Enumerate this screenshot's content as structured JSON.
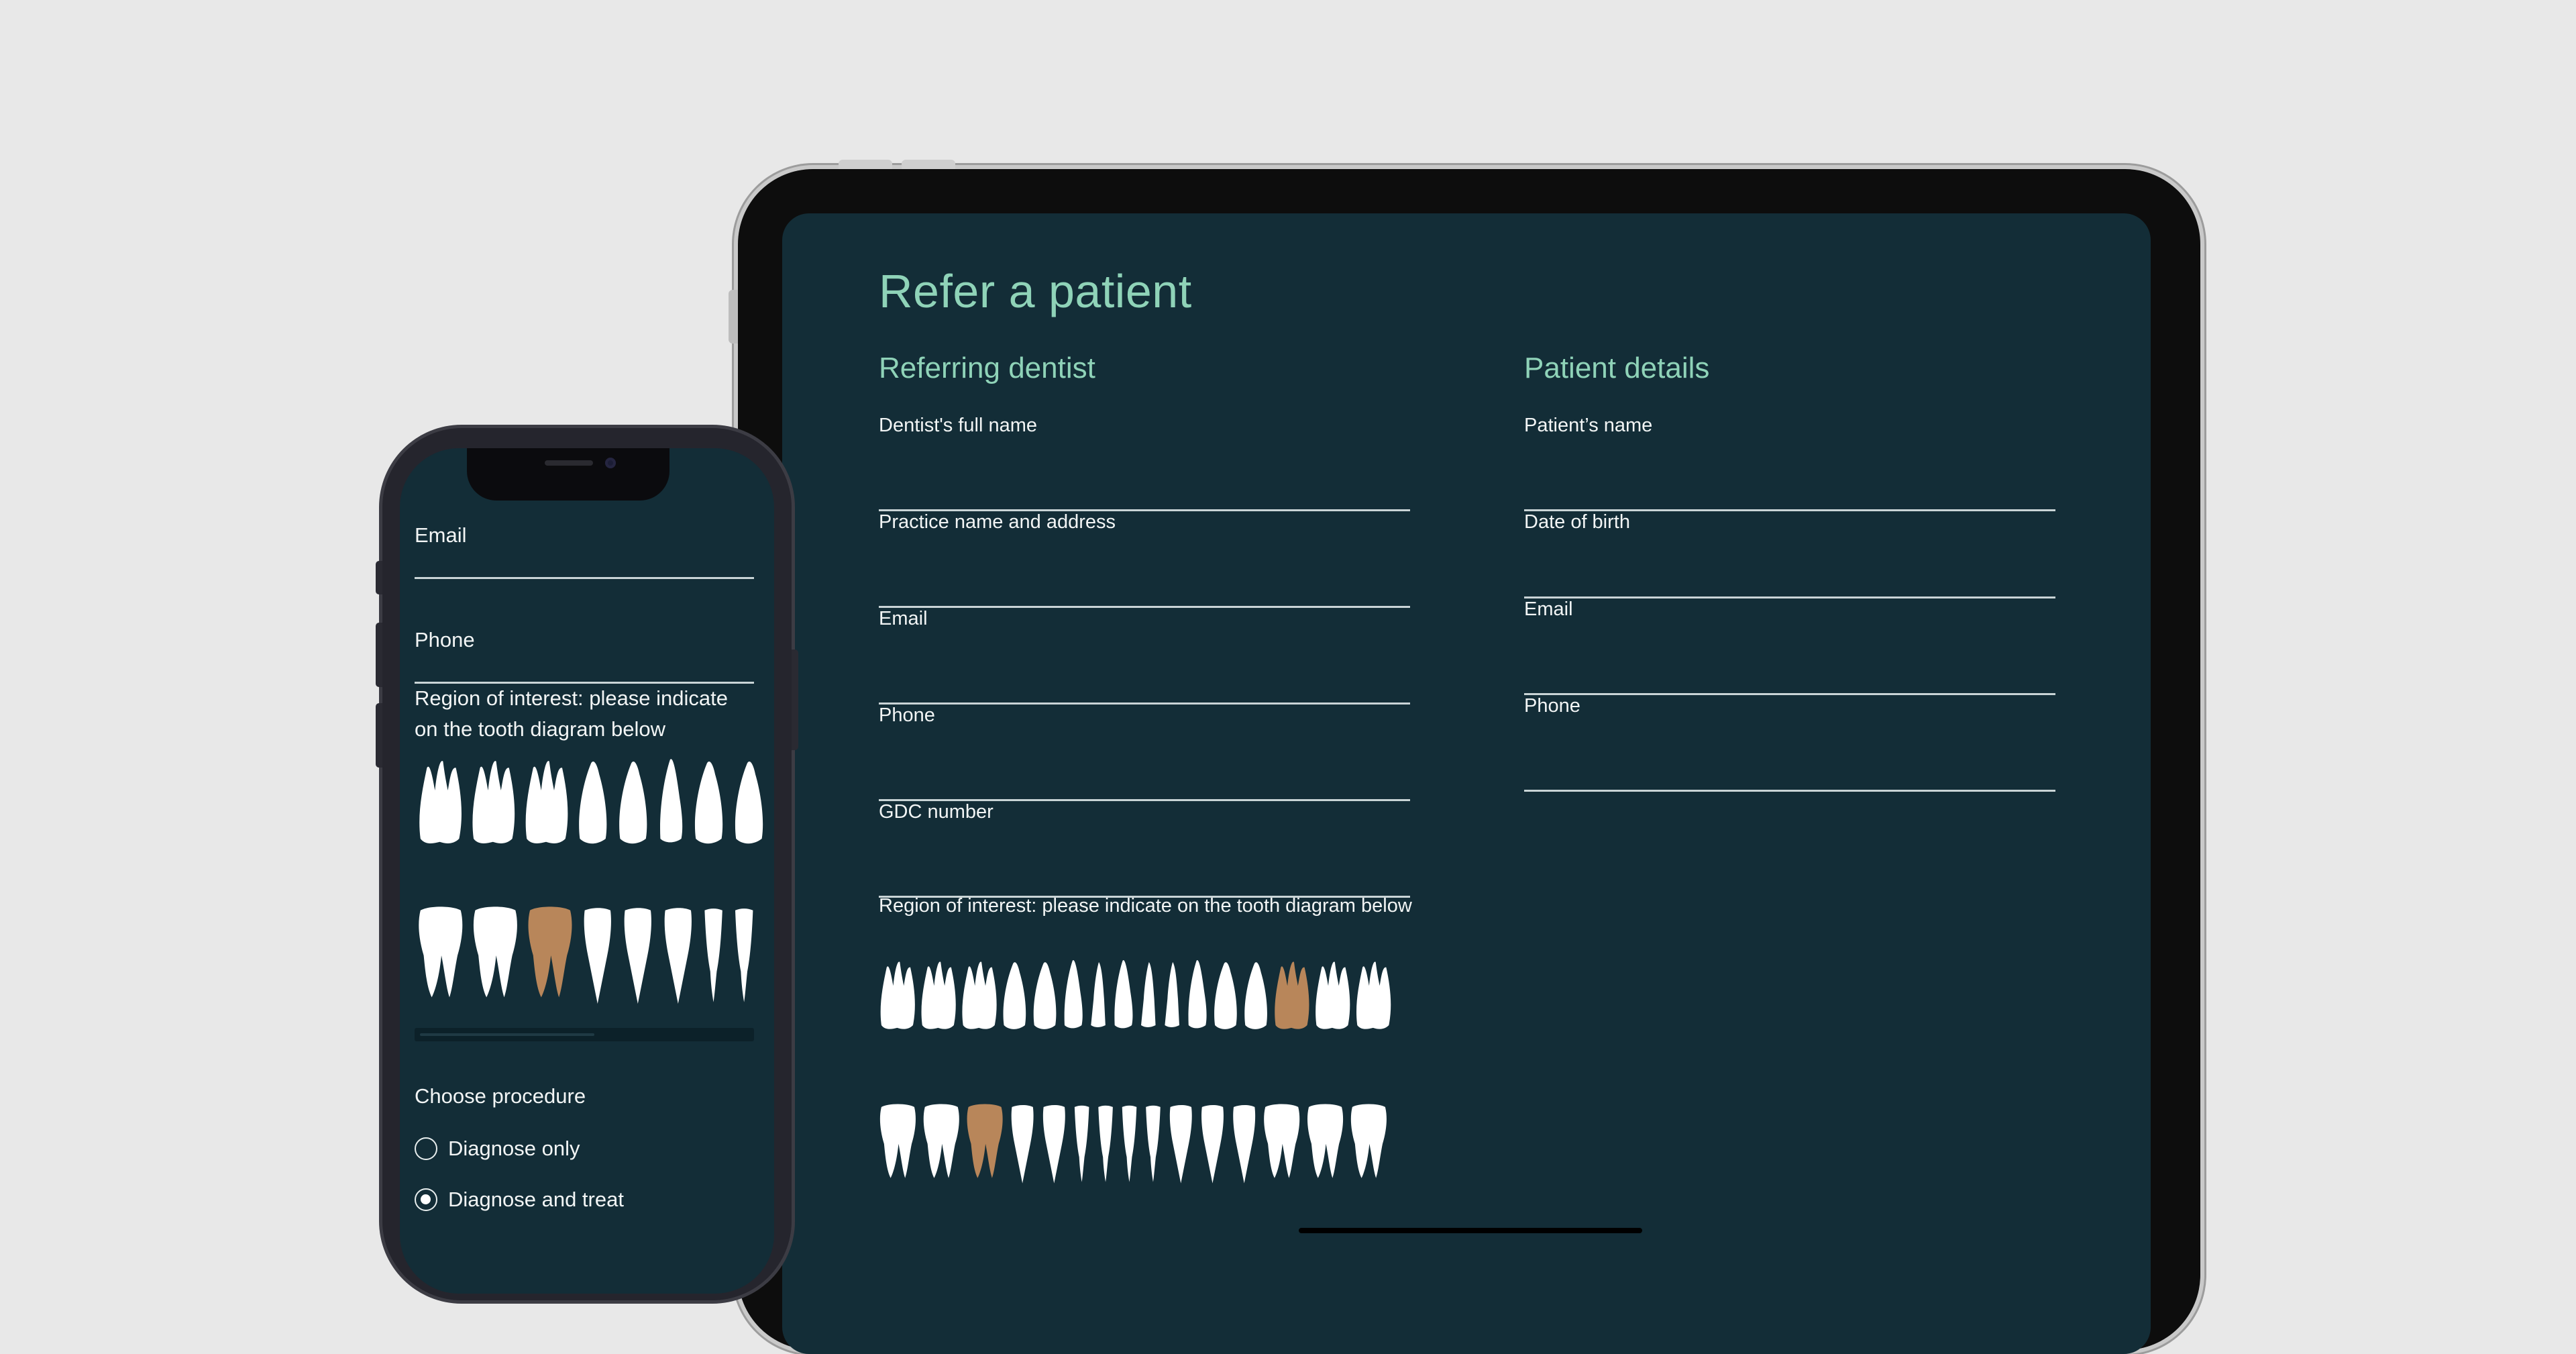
{
  "colors": {
    "background": "#e8e8e8",
    "screen_bg": "#132d37",
    "accent_heading": "#8fd3b8",
    "tooth_default": "#ffffff",
    "tooth_selected": "#b8865a",
    "field_line": "#c9d4d6"
  },
  "tablet": {
    "title": "Refer a patient",
    "referring_dentist": {
      "heading": "Referring dentist",
      "fields": [
        {
          "label": "Dentist's full name"
        },
        {
          "label": "Practice name and address"
        },
        {
          "label": "Email"
        },
        {
          "label": "Phone"
        },
        {
          "label": "GDC number"
        }
      ]
    },
    "patient_details": {
      "heading": "Patient details",
      "fields": [
        {
          "label": "Patient’s name"
        },
        {
          "label": "Date of birth"
        },
        {
          "label": "Email"
        },
        {
          "label": "Phone"
        }
      ]
    },
    "region_label": "Region of interest: please indicate on the tooth diagram below",
    "upper_teeth": [
      "molar",
      "molar",
      "molar",
      "premolar",
      "premolar",
      "canine",
      "incisor",
      "canine",
      "incisor",
      "incisor",
      "canine",
      "premolar",
      "premolar",
      "molar-selected",
      "molar",
      "molar"
    ],
    "lower_teeth": [
      "molar",
      "molar",
      "molar-selected",
      "premolar",
      "premolar",
      "incisor",
      "incisor",
      "incisor",
      "incisor",
      "premolar",
      "premolar",
      "premolar",
      "molar",
      "molar",
      "molar"
    ]
  },
  "phone": {
    "fields": [
      {
        "label": "Email"
      },
      {
        "label": "Phone"
      }
    ],
    "region_label": "Region of interest: please indicate on the tooth diagram below",
    "upper_teeth": [
      "molar",
      "molar",
      "molar",
      "premolar",
      "premolar",
      "canine",
      "premolar",
      "premolar"
    ],
    "lower_teeth": [
      "molar",
      "molar",
      "molar-selected",
      "premolar",
      "premolar",
      "premolar",
      "incisor",
      "incisor"
    ],
    "procedure": {
      "label": "Choose procedure",
      "options": [
        {
          "label": "Diagnose only",
          "selected": false
        },
        {
          "label": "Diagnose and treat",
          "selected": true
        }
      ]
    }
  }
}
